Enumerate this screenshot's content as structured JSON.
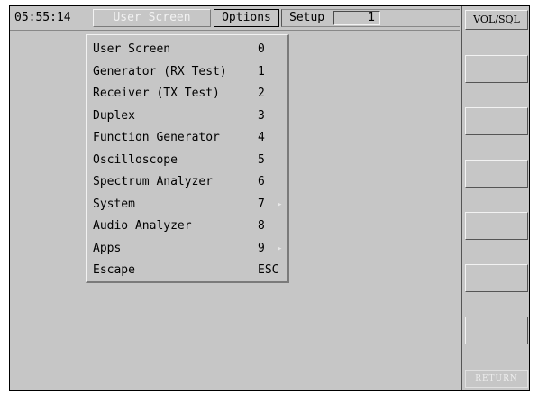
{
  "header": {
    "time": "05:55:14",
    "screen_button_label": "User Screen",
    "options_button_label": "Options",
    "setup_label": "Setup",
    "setup_value": "1"
  },
  "menu": {
    "items": [
      {
        "label": "User Screen",
        "key": "0",
        "has_submenu": false
      },
      {
        "label": "Generator (RX Test)",
        "key": "1",
        "has_submenu": false
      },
      {
        "label": "Receiver (TX Test)",
        "key": "2",
        "has_submenu": false
      },
      {
        "label": "Duplex",
        "key": "3",
        "has_submenu": false
      },
      {
        "label": "Function Generator",
        "key": "4",
        "has_submenu": false
      },
      {
        "label": "Oscilloscope",
        "key": "5",
        "has_submenu": false
      },
      {
        "label": "Spectrum Analyzer",
        "key": "6",
        "has_submenu": false
      },
      {
        "label": "System",
        "key": "7",
        "has_submenu": true
      },
      {
        "label": "Audio Analyzer",
        "key": "8",
        "has_submenu": false
      },
      {
        "label": "Apps",
        "key": "9",
        "has_submenu": true
      },
      {
        "label": "Escape",
        "key": "ESC",
        "has_submenu": false
      }
    ],
    "submenu_icon": "triangle-right-icon",
    "submenu_symbol": "▸"
  },
  "softkeys": {
    "top_label": "VOL/SQL",
    "blank_count": 6,
    "return_label": "RETURN"
  },
  "colors": {
    "panel": "#c6c6c6",
    "highlight": "#f2f2f2",
    "shadow": "#7b7b7b",
    "text": "#000000"
  }
}
